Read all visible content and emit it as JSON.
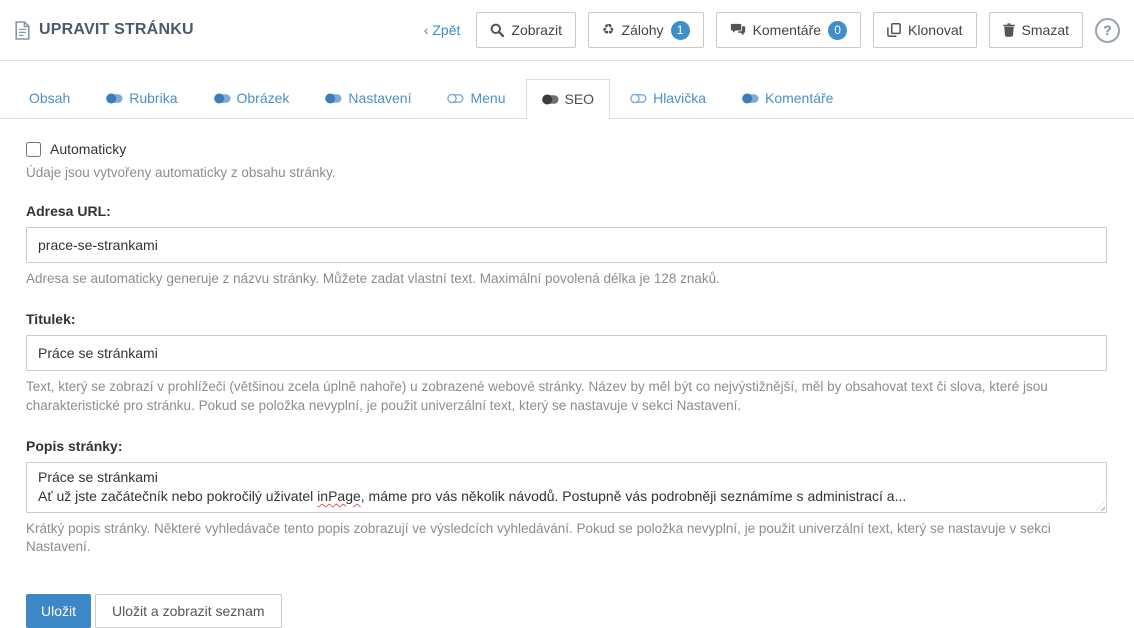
{
  "colors": {
    "accent_blue": "#3d8ec9",
    "primary_button_blue": "#3c87c5",
    "tab_link_blue": "#4a90c9",
    "title_dark": "#4a5a6b",
    "helper_gray": "#8d8d8d"
  },
  "icons": {
    "back_chevron": "‹",
    "recycle": "♻",
    "help": "?"
  },
  "header": {
    "title": "UPRAVIT STRÁNKU",
    "back_label": "Zpět",
    "view_label": "Zobrazit",
    "backups_label": "Zálohy",
    "backups_badge": "1",
    "comments_label": "Komentáře",
    "comments_badge": "0",
    "clone_label": "Klonovat",
    "delete_label": "Smazat"
  },
  "tabs": [
    {
      "label": "Obsah",
      "icon": null,
      "active": false
    },
    {
      "label": "Rubrika",
      "icon": "toggle-on-icon",
      "active": false
    },
    {
      "label": "Obrázek",
      "icon": "toggle-on-icon",
      "active": false
    },
    {
      "label": "Nastavení",
      "icon": "toggle-on-icon",
      "active": false
    },
    {
      "label": "Menu",
      "icon": "toggle-off-icon",
      "active": false
    },
    {
      "label": "SEO",
      "icon": "toggle-on-icon",
      "active": true
    },
    {
      "label": "Hlavička",
      "icon": "toggle-off-icon",
      "active": false
    },
    {
      "label": "Komentáře",
      "icon": "toggle-on-icon",
      "active": false
    }
  ],
  "form": {
    "auto": {
      "label": "Automaticky",
      "checked": false,
      "help": "Údaje jsou vytvořeny automaticky z obsahu stránky."
    },
    "url": {
      "label": "Adresa URL:",
      "value": "prace-se-strankami",
      "help": "Adresa se automaticky generuje z názvu stránky. Můžete zadat vlastní text. Maximální povolená délka je 128 znaků."
    },
    "title": {
      "label": "Titulek:",
      "value": "Práce se stránkami",
      "help": "Text, který se zobrazí v prohlížeči (většinou zcela úplně nahoře) u zobrazené webové stránky. Název by měl být co nejvýstižnější, měl by obsahovat text či slova, které jsou charakteristické pro stránku. Pokud se položka nevyplní, je použit univerzální text, který se nastavuje v sekci Nastavení."
    },
    "description": {
      "label": "Popis stránky:",
      "line1": "Práce se stránkami",
      "line2_before": "Ať už jste začátečník nebo pokročilý uživatel ",
      "line2_word": "inPage",
      "line2_after": ", máme pro vás několik návodů. Postupně vás podrobněji seznámíme s administrací a...",
      "help": "Krátký popis stránky. Některé vyhledávače tento popis zobrazují ve výsledcích vyhledávání. Pokud se položka nevyplní, je použit univerzální text, který se nastavuje v sekci Nastavení."
    }
  },
  "footer": {
    "save_label": "Uložit",
    "save_and_list_label": "Uložit a zobrazit seznam"
  }
}
